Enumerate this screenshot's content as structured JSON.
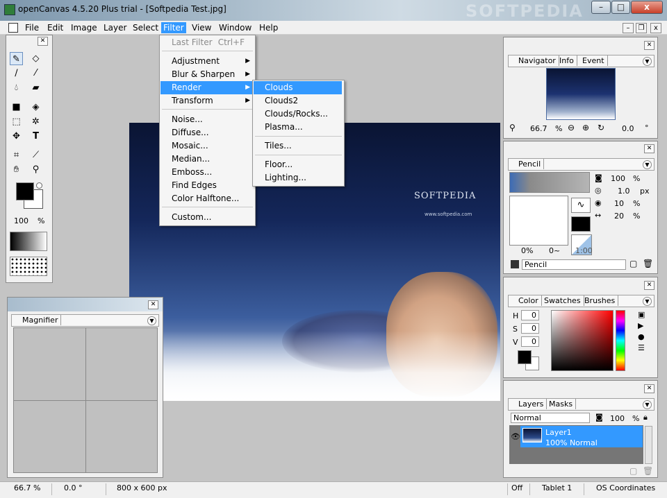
{
  "window": {
    "title": "openCanvas 4.5.20 Plus trial - [Softpedia Test.jpg]",
    "watermark": "SOFTPEDIA",
    "controls": {
      "minimize": "–",
      "maximize": "□",
      "close": "x"
    }
  },
  "menubar": {
    "items": [
      "File",
      "Edit",
      "Image",
      "Layer",
      "Select",
      "Filter",
      "View",
      "Window",
      "Help"
    ],
    "active": "Filter",
    "mdi": {
      "minimize": "–",
      "restore": "❐",
      "close": "x"
    }
  },
  "filter_menu": {
    "items": [
      {
        "label": "Last Filter",
        "shortcut": "Ctrl+F",
        "disabled": true
      },
      {
        "label": "Adjustment",
        "submenu": true
      },
      {
        "label": "Blur & Sharpen",
        "submenu": true
      },
      {
        "label": "Render",
        "submenu": true,
        "active": true
      },
      {
        "label": "Transform",
        "submenu": true
      },
      {
        "label": "Noise..."
      },
      {
        "label": "Diffuse..."
      },
      {
        "label": "Mosaic..."
      },
      {
        "label": "Median..."
      },
      {
        "label": "Emboss..."
      },
      {
        "label": "Find Edges"
      },
      {
        "label": "Color Halftone..."
      },
      {
        "label": "Custom..."
      }
    ]
  },
  "render_menu": {
    "items": [
      "Clouds",
      "Clouds2",
      "Clouds/Rocks...",
      "Plasma...",
      "Tiles...",
      "Floor...",
      "Lighting..."
    ],
    "active": "Clouds"
  },
  "canvas": {
    "brand_text": "SOFTPEDIA",
    "url_text": "www.softpedia.com"
  },
  "toolbox": {
    "tools": [
      "pencil-icon",
      "eraser-icon",
      "brush-icon",
      "airbrush-icon",
      "water-icon",
      "marker-icon",
      "fill-rect-icon",
      "bucket-icon",
      "marquee-icon",
      "wand-icon",
      "move-icon",
      "text-icon",
      "crop-icon",
      "eyedropper-icon",
      "hand-icon",
      "zoom-icon"
    ],
    "opacity_value": "100",
    "opacity_unit": "%",
    "primary_color": "#000000",
    "secondary_color": "#ffffff"
  },
  "magnifier": {
    "tab": "Magnifier"
  },
  "navigator": {
    "tabs": [
      "Navigator",
      "Info",
      "Event"
    ],
    "zoom_value": "66.7",
    "zoom_unit": "%",
    "rotation_value": "0.0",
    "rotation_unit": "°"
  },
  "pencil_panel": {
    "tab": "Pencil",
    "opacity_value": "100",
    "opacity_unit": "%",
    "size_value": "1.0",
    "size_unit": "px",
    "density_value": "10",
    "density_unit": "%",
    "angle_value": "20",
    "angle_unit": "%",
    "preview_min": "0%",
    "preview_max": "0~",
    "scale_value": "1:00",
    "preset_name": "Pencil"
  },
  "color_panel": {
    "tabs": [
      "Color",
      "Swatches",
      "Brushes"
    ],
    "h_label": "H",
    "h_value": "0",
    "s_label": "S",
    "s_value": "0",
    "v_label": "V",
    "v_value": "0",
    "picker_hue": "#ff0000",
    "foreground": "#000000"
  },
  "layers_panel": {
    "tabs": [
      "Layers",
      "Masks"
    ],
    "blend_mode": "Normal",
    "opacity_value": "100",
    "opacity_unit": "%",
    "layers": [
      {
        "name": "Layer1",
        "detail": "100% Normal",
        "selected": true
      }
    ]
  },
  "statusbar": {
    "zoom": "66.7 %",
    "rotation": "0.0 °",
    "size": "800 x 600 px",
    "mode": "Off",
    "device": "Tablet 1",
    "coords": "OS Coordinates"
  }
}
